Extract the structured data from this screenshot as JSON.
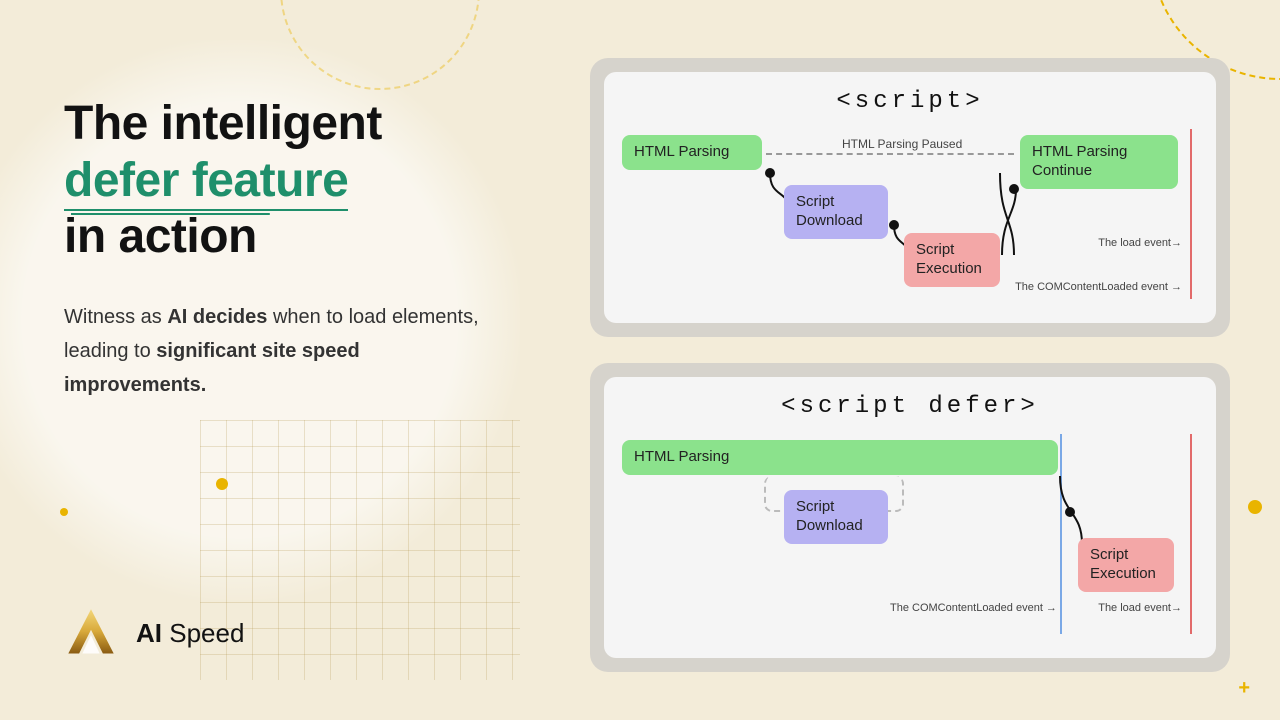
{
  "headline": {
    "line1": "The intelligent",
    "accent": "defer feature",
    "line3": "in action"
  },
  "sub": {
    "pre": "Witness as ",
    "bold1": "AI decides",
    "mid": " when to load elements, leading to ",
    "bold2": "significant site speed improvements."
  },
  "brand": {
    "bold": "AI",
    "rest": " Speed"
  },
  "panel1": {
    "title": "<script>",
    "html_parsing": "HTML Parsing",
    "paused": "HTML Parsing Paused",
    "script_download": "Script\nDownload",
    "script_execution": "Script\nExecution",
    "html_continue": "HTML Parsing\nContinue",
    "load_event": "The load event→",
    "dom_event": "The COMContentLoaded event  →"
  },
  "panel2": {
    "title": "<script defer>",
    "html_parsing": "HTML Parsing",
    "script_download": "Script\nDownload",
    "script_execution": "Script\nExecution",
    "dom_event": "The COMContentLoaded event  →",
    "load_event": "The load event→"
  },
  "chart_data": [
    {
      "type": "timeline",
      "label": "<script>",
      "lanes": [
        {
          "name": "HTML Parsing",
          "spans": [
            {
              "start": 0,
              "end": 25,
              "label": "HTML Parsing"
            },
            {
              "start": 72,
              "end": 100,
              "label": "HTML Parsing Continue"
            }
          ]
        },
        {
          "name": "Script",
          "spans": [
            {
              "start": 28,
              "end": 48,
              "label": "Script Download"
            },
            {
              "start": 50,
              "end": 68,
              "label": "Script Execution"
            }
          ]
        }
      ],
      "annotations": [
        {
          "text": "HTML Parsing Paused",
          "from": 25,
          "to": 72
        },
        {
          "text": "The COMContentLoaded event",
          "at": 100
        },
        {
          "text": "The load event",
          "at": 100
        }
      ]
    },
    {
      "type": "timeline",
      "label": "<script defer>",
      "lanes": [
        {
          "name": "HTML Parsing",
          "spans": [
            {
              "start": 0,
              "end": 78,
              "label": "HTML Parsing"
            }
          ]
        },
        {
          "name": "Script",
          "spans": [
            {
              "start": 28,
              "end": 48,
              "label": "Script Download"
            },
            {
              "start": 82,
              "end": 100,
              "label": "Script Execution"
            }
          ]
        }
      ],
      "annotations": [
        {
          "text": "The COMContentLoaded event",
          "at": 78
        },
        {
          "text": "The load event",
          "at": 100
        }
      ]
    }
  ]
}
